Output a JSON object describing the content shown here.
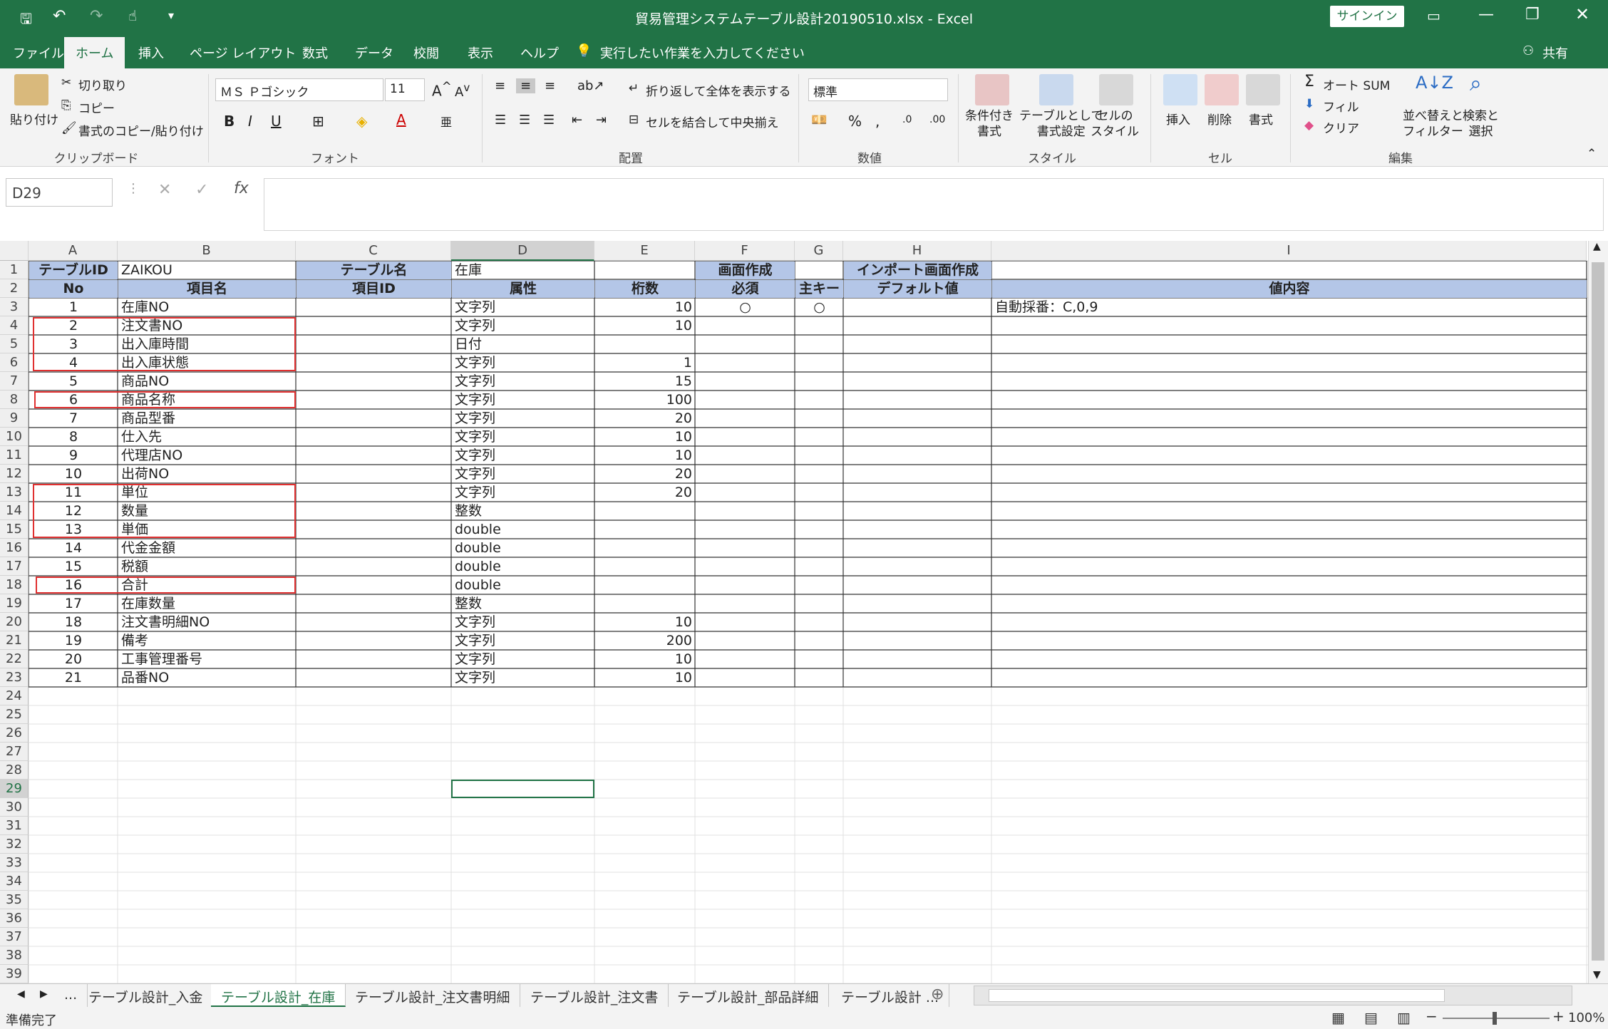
{
  "title": "貿易管理システムテーブル設計20190510.xlsx  -  Excel",
  "signin": "サインイン",
  "share": "共有",
  "ribbon_tabs": [
    "ファイル",
    "ホーム",
    "挿入",
    "ページ レイアウト",
    "数式",
    "データ",
    "校閲",
    "表示",
    "ヘルプ"
  ],
  "tell_me": "実行したい作業を入力してください",
  "ribbon": {
    "clipboard": {
      "paste": "貼り付け",
      "cut": "切り取り",
      "copy": "コピー",
      "format_painter": "書式のコピー/貼り付け",
      "label": "クリップボード"
    },
    "font": {
      "name": "ＭＳ Ｐゴシック",
      "size": "11",
      "label": "フォント",
      "bold": "B",
      "italic": "I",
      "underline": "U"
    },
    "alignment": {
      "wrap": "折り返して全体を表示する",
      "merge": "セルを結合して中央揃え",
      "label": "配置"
    },
    "number": {
      "format": "標準",
      "label": "数値"
    },
    "styles": {
      "conditional": "条件付き\n書式",
      "as_table": "テーブルとして\n書式設定",
      "cell_styles": "セルの\nスタイル",
      "label": "スタイル"
    },
    "cells": {
      "insert": "挿入",
      "delete": "削除",
      "format": "書式",
      "label": "セル"
    },
    "editing": {
      "autosum": "オート SUM",
      "fill": "フィル",
      "clear": "クリア",
      "sort": "並べ替えと\nフィルター",
      "find": "検索と\n選択",
      "label": "編集"
    }
  },
  "name_box": "D29",
  "columns": [
    "A",
    "B",
    "C",
    "D",
    "E",
    "F",
    "G",
    "H",
    "I"
  ],
  "row1": {
    "a": "テーブルID",
    "b": "ZAIKOU",
    "c": "テーブル名",
    "d": "在庫",
    "f": "画面作成",
    "h": "インポート画面作成"
  },
  "headers": {
    "no": "No",
    "item": "項目名",
    "itemid": "項目ID",
    "attr": "属性",
    "digits": "桁数",
    "required": "必須",
    "key": "主キー",
    "default": "デフォルト値",
    "value": "値内容"
  },
  "rows": [
    {
      "no": "1",
      "name": "在庫NO",
      "attr": "文字列",
      "digits": "10",
      "req": "○",
      "key": "○",
      "value": "自動採番：C,0,9"
    },
    {
      "no": "2",
      "name": "注文書NO",
      "attr": "文字列",
      "digits": "10"
    },
    {
      "no": "3",
      "name": "出入庫時間",
      "attr": "日付",
      "digits": ""
    },
    {
      "no": "4",
      "name": "出入庫状態",
      "attr": "文字列",
      "digits": "1"
    },
    {
      "no": "5",
      "name": "商品NO",
      "attr": "文字列",
      "digits": "15"
    },
    {
      "no": "6",
      "name": "商品名称",
      "attr": "文字列",
      "digits": "100"
    },
    {
      "no": "7",
      "name": "商品型番",
      "attr": "文字列",
      "digits": "20"
    },
    {
      "no": "8",
      "name": "仕入先",
      "attr": "文字列",
      "digits": "10"
    },
    {
      "no": "9",
      "name": "代理店NO",
      "attr": "文字列",
      "digits": "10"
    },
    {
      "no": "10",
      "name": "出荷NO",
      "attr": "文字列",
      "digits": "20"
    },
    {
      "no": "11",
      "name": "単位",
      "attr": "文字列",
      "digits": "20"
    },
    {
      "no": "12",
      "name": "数量",
      "attr": "整数",
      "digits": ""
    },
    {
      "no": "13",
      "name": "単価",
      "attr": "double",
      "digits": ""
    },
    {
      "no": "14",
      "name": "代金金額",
      "attr": "double",
      "digits": ""
    },
    {
      "no": "15",
      "name": "税額",
      "attr": "double",
      "digits": ""
    },
    {
      "no": "16",
      "name": "合計",
      "attr": "double",
      "digits": ""
    },
    {
      "no": "17",
      "name": "在庫数量",
      "attr": "整数",
      "digits": ""
    },
    {
      "no": "18",
      "name": "注文書明細NO",
      "attr": "文字列",
      "digits": "10"
    },
    {
      "no": "19",
      "name": "備考",
      "attr": "文字列",
      "digits": "200"
    },
    {
      "no": "20",
      "name": "工事管理番号",
      "attr": "文字列",
      "digits": "10"
    },
    {
      "no": "21",
      "name": "品番NO",
      "attr": "文字列",
      "digits": "10"
    }
  ],
  "sheet_tabs": [
    "...",
    "テーブル設計_入金",
    "テーブル設計_在庫",
    "テーブル設計_注文書明細",
    "テーブル設計_注文書",
    "テーブル設計_部品詳細",
    "テーブル設計 ..."
  ],
  "status": "準備完了",
  "zoom": "100%",
  "colors": {
    "excel_green": "#217346",
    "header_fill": "#b4c6e7",
    "highlight_border": "#e03030"
  }
}
